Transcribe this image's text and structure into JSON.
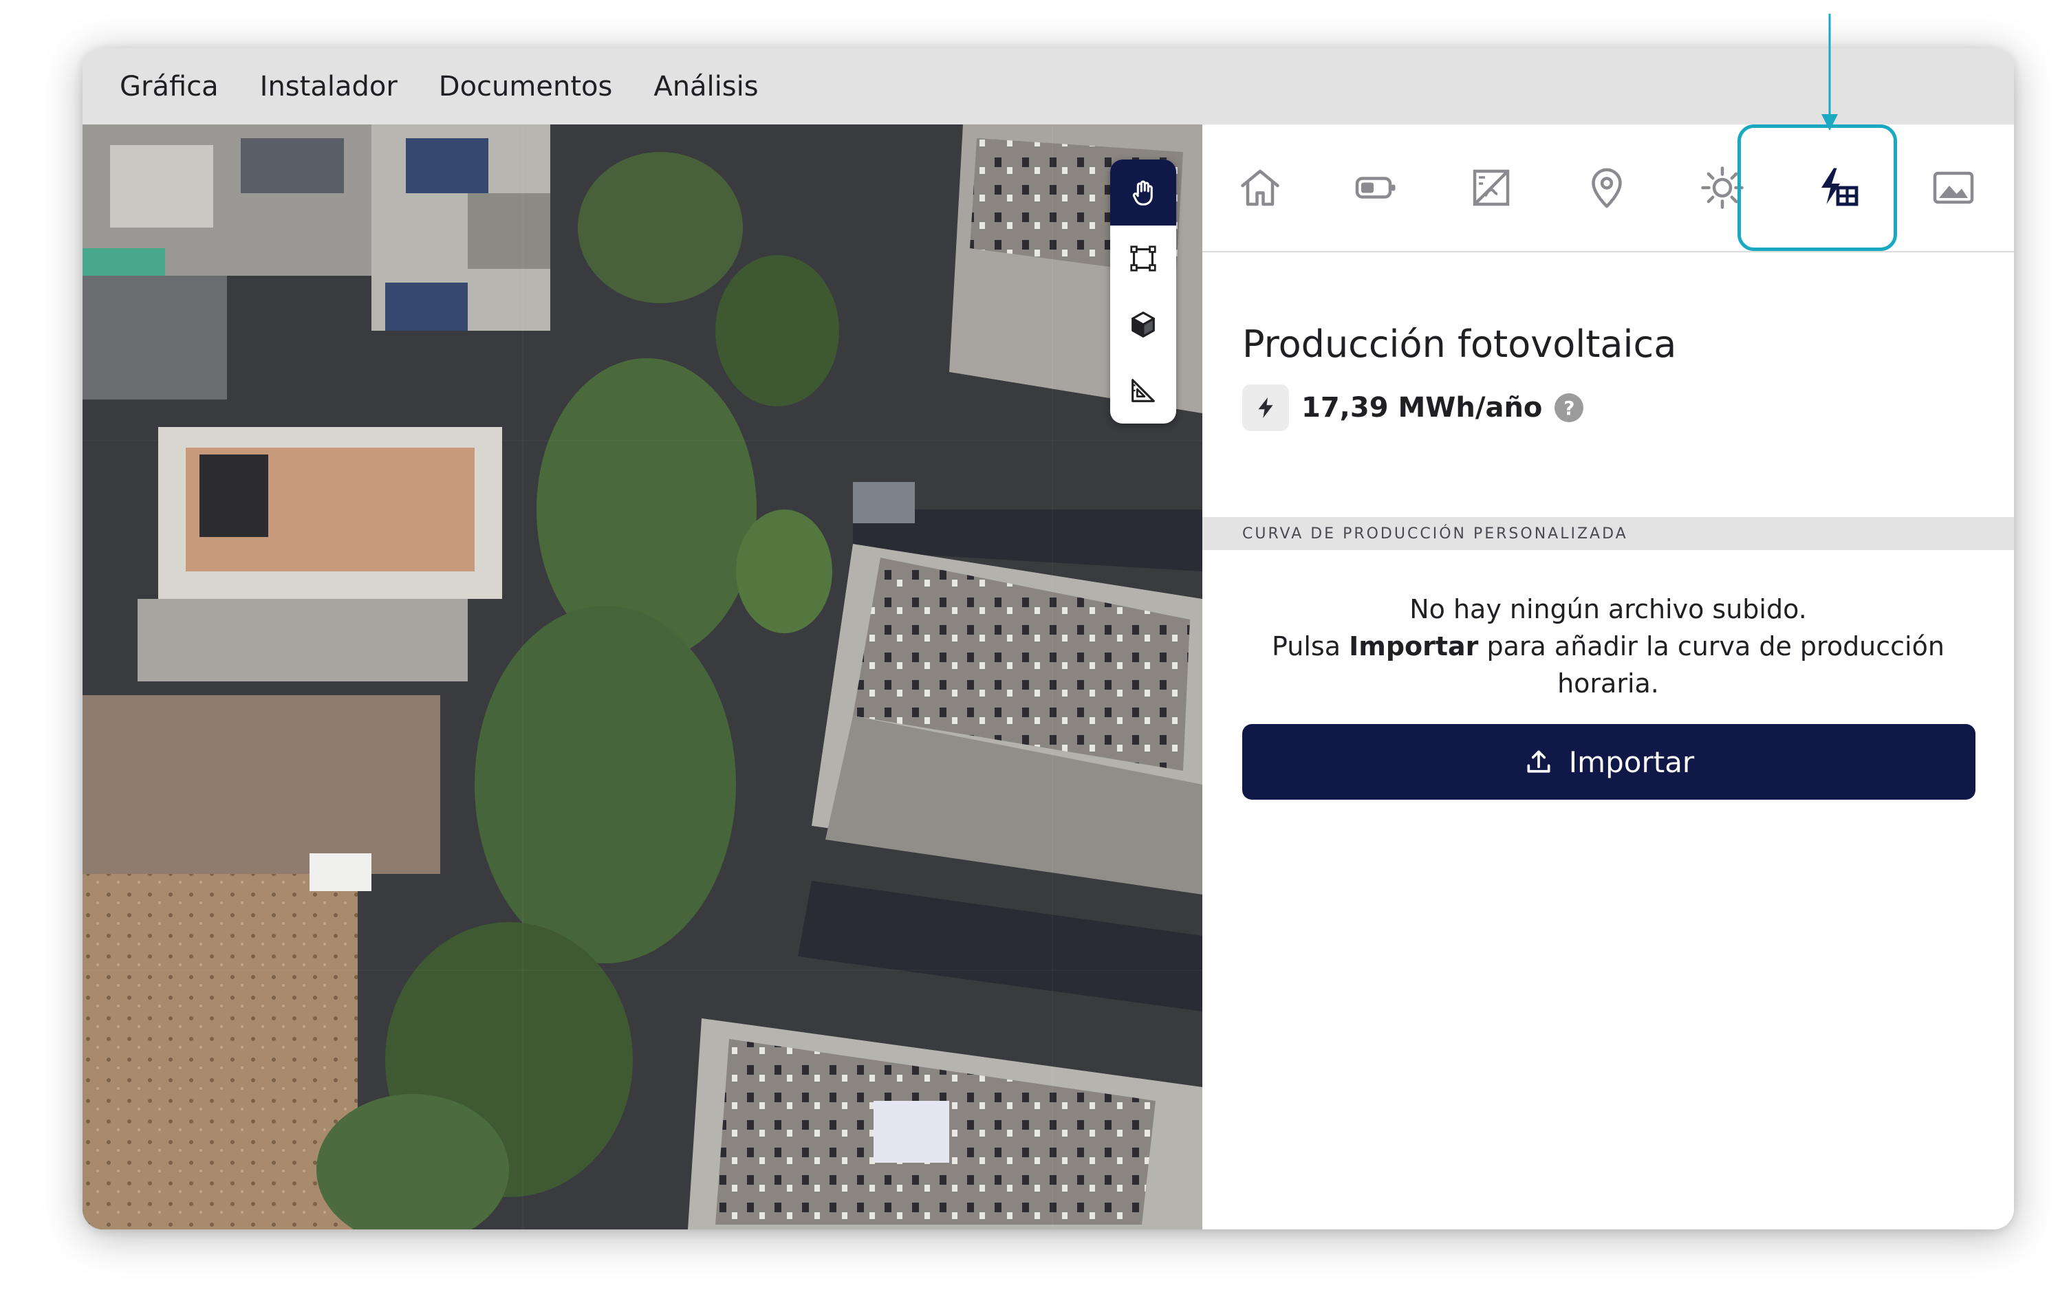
{
  "menubar": {
    "items": [
      "Gráfica",
      "Instalador",
      "Documentos",
      "Análisis"
    ]
  },
  "map": {
    "tools": [
      {
        "name": "hand-icon",
        "active": true
      },
      {
        "name": "polygon-select-icon",
        "active": false
      },
      {
        "name": "cube-icon",
        "active": false
      },
      {
        "name": "set-square-icon",
        "active": false
      }
    ]
  },
  "tabs": [
    {
      "icon": "home-icon"
    },
    {
      "icon": "battery-icon"
    },
    {
      "icon": "solar-panel-icon"
    },
    {
      "icon": "location-pin-icon"
    },
    {
      "icon": "sun-icon"
    },
    {
      "icon": "pv-production-icon",
      "selected": true
    },
    {
      "icon": "image-icon"
    }
  ],
  "panel": {
    "title": "Producción fotovoltaica",
    "energy": {
      "value": "17,39 MWh/año",
      "help": "?"
    },
    "section_header": "CURVA DE PRODUCCIÓN PERSONALIZADA",
    "empty_message": {
      "line1": "No hay ningún archivo subido.",
      "pre": "Pulsa ",
      "emphasis": "Importar",
      "post": " para añadir la curva de producción horaria."
    },
    "import_button": "Importar"
  },
  "colors": {
    "primary": "#101848",
    "highlight": "#1aa9c1",
    "menubar": "#e2e2e2",
    "section": "#e3e3e3"
  }
}
